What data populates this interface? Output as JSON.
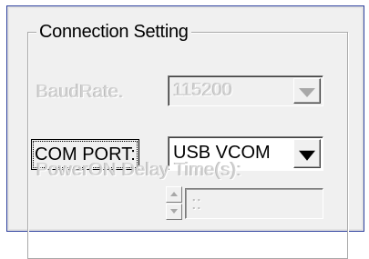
{
  "group": {
    "title": "Connection Setting"
  },
  "baud_rate": {
    "label": "BaudRate.",
    "value": "115200",
    "enabled": false
  },
  "com_port": {
    "label": "COM PORT:",
    "value": "USB VCOM",
    "enabled": true
  },
  "power_on_delay": {
    "label": "PowerON Delay Time(s):",
    "value": "::",
    "enabled": false
  },
  "colors": {
    "frame_border": "#2c3f9e",
    "dialog_bg": "#f0f0f0",
    "disabled_text": "#d4d4d4"
  }
}
